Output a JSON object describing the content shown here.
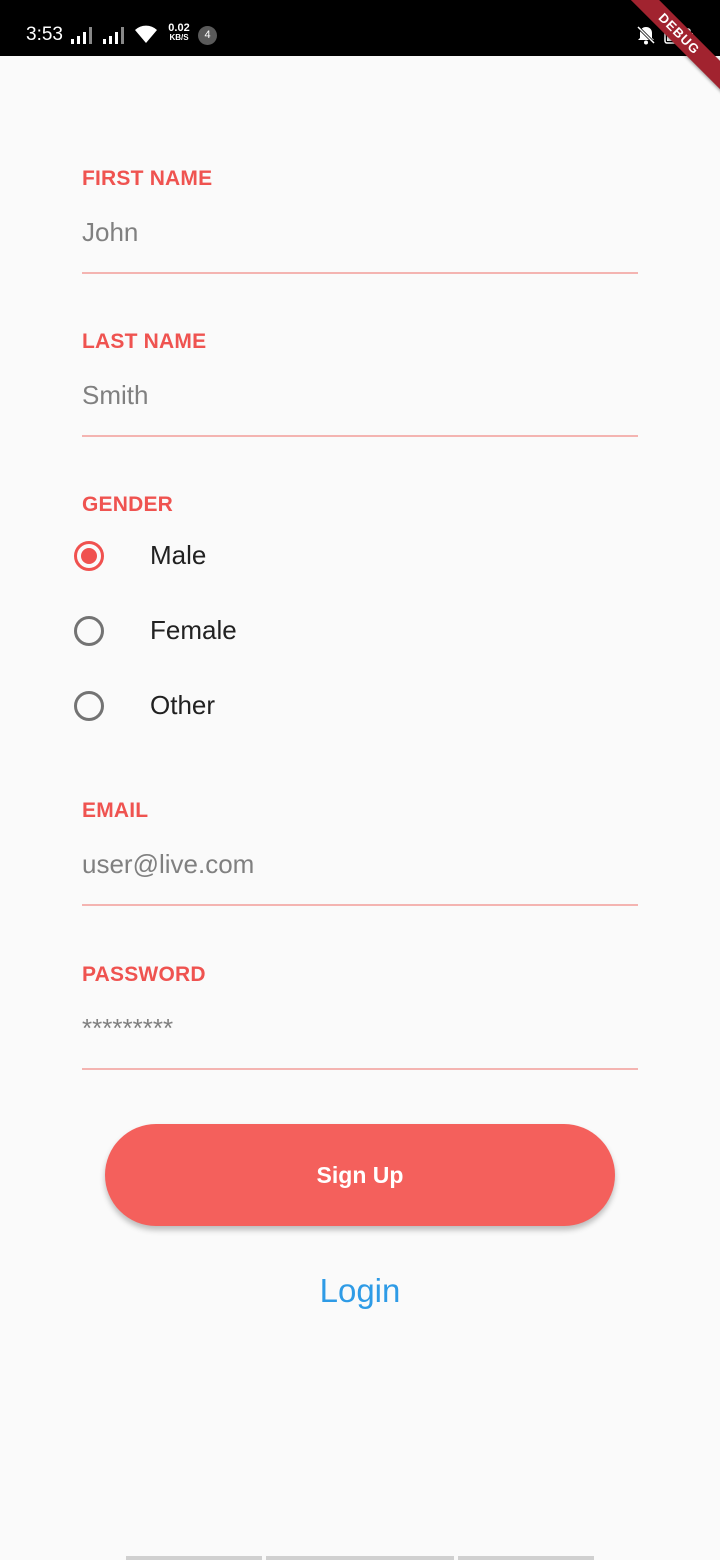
{
  "status_bar": {
    "time": "3:53",
    "net_speed_value": "0.02",
    "net_speed_unit": "KB/S",
    "notification_count": "4",
    "icons": [
      "signal-icon",
      "signal-icon",
      "wifi-icon",
      "bell-muted-icon",
      "battery-icon"
    ]
  },
  "debug_banner": "DEBUG",
  "form": {
    "first_name": {
      "label": "FIRST NAME",
      "placeholder": "John"
    },
    "last_name": {
      "label": "LAST NAME",
      "placeholder": "Smith"
    },
    "gender": {
      "label": "GENDER",
      "options": [
        {
          "label": "Male",
          "selected": true
        },
        {
          "label": "Female",
          "selected": false
        },
        {
          "label": "Other",
          "selected": false
        }
      ]
    },
    "email": {
      "label": "EMAIL",
      "placeholder": "user@live.com"
    },
    "password": {
      "label": "PASSWORD",
      "placeholder": "*********"
    },
    "signup_label": "Sign Up",
    "login_label": "Login"
  },
  "colors": {
    "accent": "#ef5350",
    "button": "#f4605c",
    "link": "#2e9be6",
    "underline": "#f4b4b1"
  }
}
